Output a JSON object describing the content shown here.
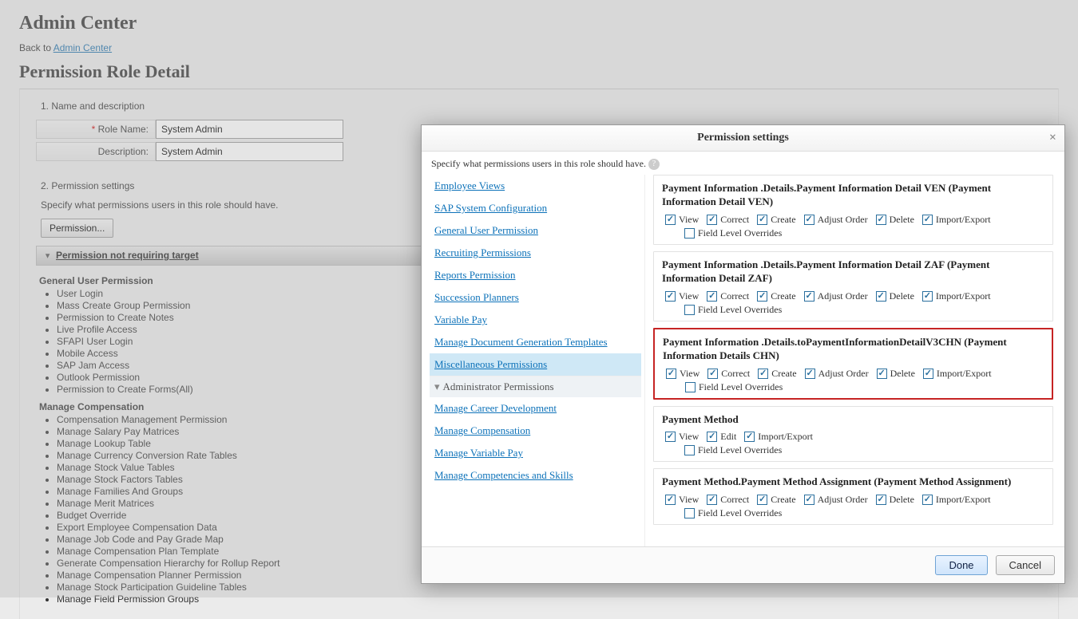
{
  "page": {
    "title": "Admin Center",
    "back_prefix": "Back to ",
    "back_link": "Admin Center",
    "section_title": "Permission Role Detail"
  },
  "form": {
    "step1": "1. Name and description",
    "role_name_label": "Role Name:",
    "role_name_value": "System Admin",
    "description_label": "Description:",
    "description_value": "System Admin",
    "step2": "2. Permission settings",
    "help": "Specify what permissions users in this role should have.",
    "perm_button": "Permission...",
    "accordion": "Permission not requiring target"
  },
  "tree": {
    "cat1": "General User Permission",
    "cat1_items": [
      "User Login",
      "Mass Create Group Permission",
      "Permission to Create Notes",
      "Live Profile Access",
      "SFAPI User Login",
      "Mobile Access",
      "SAP Jam Access",
      "Outlook Permission",
      "Permission to Create Forms(All)"
    ],
    "cat2": "Manage Compensation",
    "cat2_items": [
      "Compensation Management Permission",
      "Manage Salary Pay Matrices",
      "Manage Lookup Table",
      "Manage Currency Conversion Rate Tables",
      "Manage Stock Value Tables",
      "Manage Stock Factors Tables",
      "Manage Families And Groups",
      "Manage Merit Matrices",
      "Budget Override",
      "Export Employee Compensation Data",
      "Manage Job Code and Pay Grade Map",
      "Manage Compensation Plan Template",
      "Generate Compensation Hierarchy for Rollup Report",
      "Manage Compensation Planner Permission",
      "Manage Stock Participation Guideline Tables",
      "Manage Field Permission Groups"
    ]
  },
  "modal": {
    "title": "Permission settings",
    "help": "Specify what permissions users in this role should have.",
    "left": {
      "links_top": [
        "Employee Views",
        "SAP System Configuration",
        "General User Permission",
        "Recruiting Permissions",
        "Reports Permission",
        "Succession Planners",
        "Variable Pay",
        "Manage Document Generation Templates",
        "Miscellaneous Permissions"
      ],
      "group": "Administrator Permissions",
      "links_bottom": [
        "Manage Career Development",
        "Manage Compensation",
        "Manage Variable Pay",
        "Manage Competencies and Skills"
      ]
    },
    "perms": {
      "labels": {
        "view": "View",
        "correct": "Correct",
        "create": "Create",
        "adjust": "Adjust Order",
        "delete": "Delete",
        "import": "Import/Export",
        "edit": "Edit",
        "flo": "Field Level Overrides"
      },
      "blocks": [
        {
          "title": "Payment Information .Details.Payment Information Detail VEN (Payment Information Detail VEN)",
          "type": "full",
          "highlight": false
        },
        {
          "title": "Payment Information .Details.Payment Information Detail ZAF (Payment Information Detail ZAF)",
          "type": "full",
          "highlight": false
        },
        {
          "title": "Payment Information .Details.toPaymentInformationDetailV3CHN (Payment Information Details CHN)",
          "type": "full",
          "highlight": true
        },
        {
          "title": "Payment Method",
          "type": "method",
          "highlight": false
        },
        {
          "title": "Payment Method.Payment Method Assignment (Payment Method Assignment)",
          "type": "full",
          "highlight": false
        }
      ]
    },
    "done": "Done",
    "cancel": "Cancel"
  }
}
